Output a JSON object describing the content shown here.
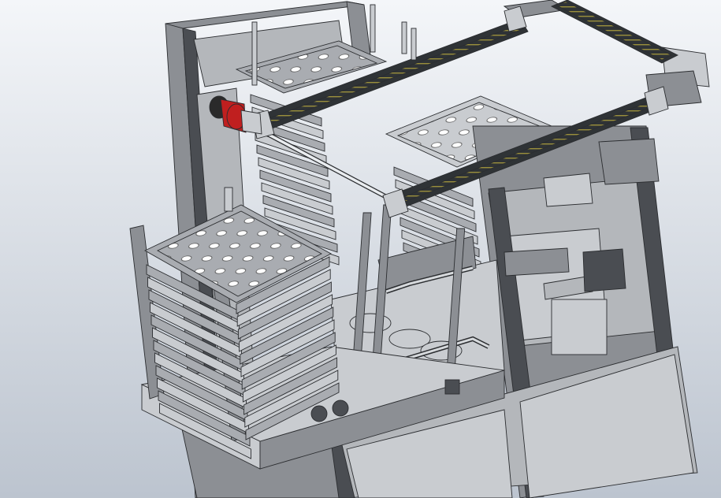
{
  "scene": {
    "background": {
      "top": "#f4f6f9",
      "bottom": "#bcc4cf"
    },
    "palette": {
      "frame": "#8c8f94",
      "frame_dark": "#4a4d52",
      "frame_light": "#c9ccd0",
      "panel": "#b4b7bb",
      "tray": "#a9acb1",
      "rail": "#2f3336",
      "rail_stripe": "#9a8f3c",
      "motor_red": "#c01f1f",
      "motor_dark": "#2a2a2a",
      "outline": "#2b2d30"
    },
    "icons": {
      "gantry_motor": "motor-icon",
      "cad_model": "3d-model-icon"
    }
  }
}
